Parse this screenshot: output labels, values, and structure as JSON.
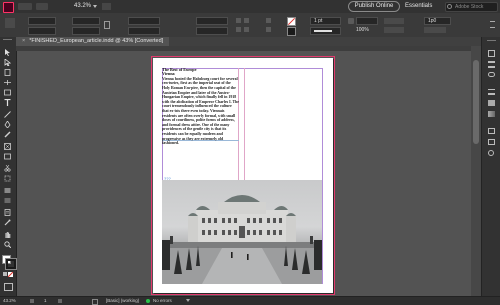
{
  "appbar": {
    "zoom": "43.2%",
    "publish_label": "Publish Online",
    "workspace": "Essentials",
    "search_placeholder": "Adobe Stock"
  },
  "control": {
    "font_size": "1 pt",
    "zoom_field": "100%",
    "gutter": "1p0"
  },
  "document": {
    "tab_title": "*FINISHED_European_article.indd @ 43% [Converted]"
  },
  "article": {
    "heading": "The Best of Europe",
    "subheading": "Vienna",
    "body": "Vienna hosted the Habsburg court for several cen-turies, first as the imperial seat of the Holy Roman Em-pire, then the capital of the Austrian Empire and later of the Austro-Hungarian Empire, which finally fell in 1918 with the abdication of Emperor Charles I. The court tremendously influenced the culture that ex-ists there even today. Viennais residents are often overly formal, with small doses of courtliness, polite forms of address, and formal dress attire. One of the many providences of the gentle city is that its residents can be equally modern and progressive as they are extremely old fashioned.",
    "overset_marker": "???"
  },
  "status": {
    "zoom": "43.2%",
    "page": "1",
    "style": "[Basic] (working)",
    "preflight": "No errors"
  },
  "colors": {
    "margin_guide": "#b08cd8",
    "column_guide": "#e0a6c8",
    "bleed": "#e23a6e",
    "preflight_ok": "#27c34a",
    "frame_select": "#7fb0e0"
  }
}
